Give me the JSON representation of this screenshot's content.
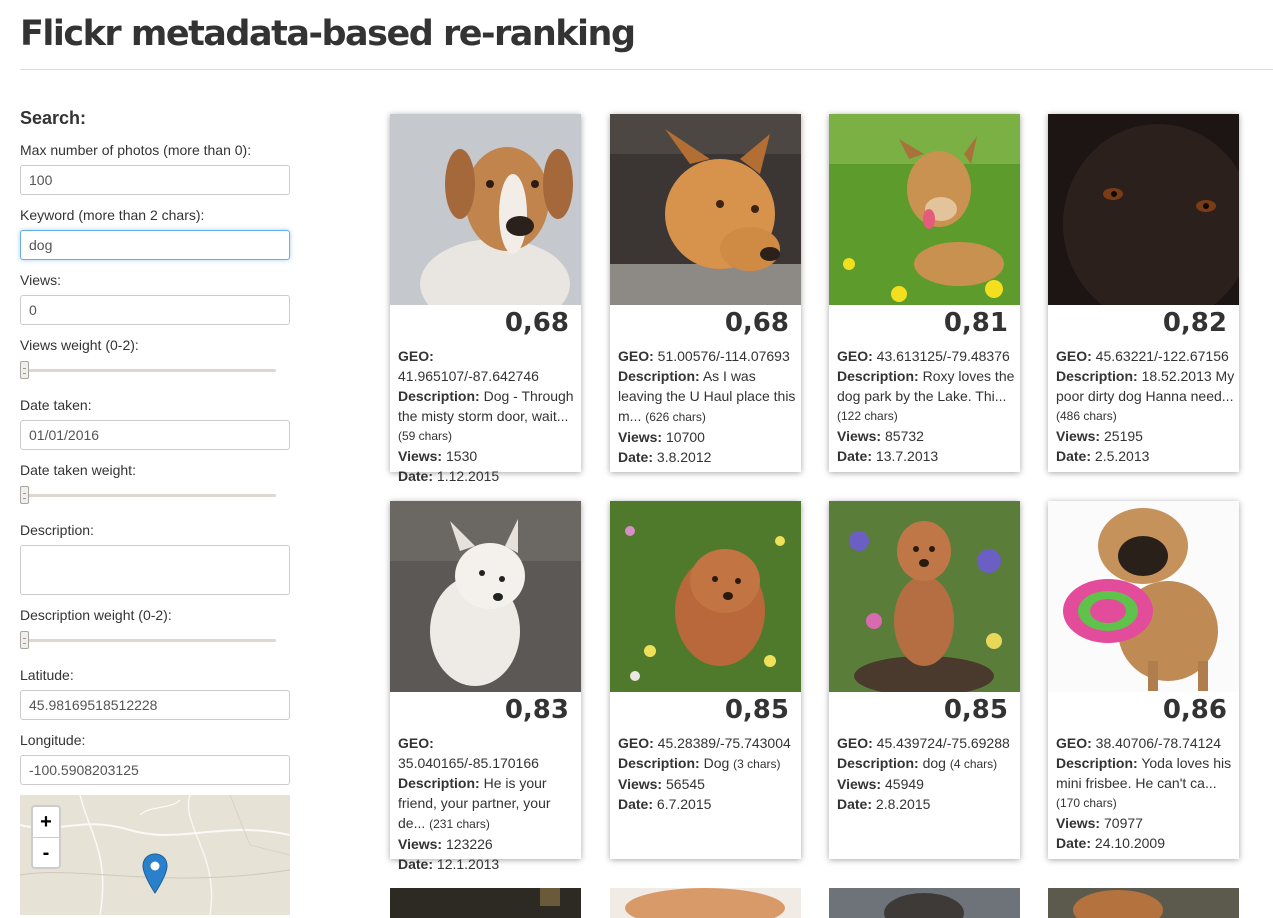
{
  "page_title": "Flickr metadata-based re-ranking",
  "sidebar": {
    "heading": "Search:",
    "max_photos_label": "Max number of photos (more than 0):",
    "max_photos_value": "100",
    "keyword_label": "Keyword (more than 2 chars):",
    "keyword_value": "dog",
    "views_label": "Views:",
    "views_value": "0",
    "views_weight_label": "Views weight (0-2):",
    "views_weight": 0,
    "date_label": "Date taken:",
    "date_value": "01/01/2016",
    "date_weight_label": "Date taken weight:",
    "date_weight": 0,
    "description_label": "Description:",
    "description_value": "",
    "description_weight_label": "Description weight (0-2):",
    "description_weight": 0,
    "latitude_label": "Latitude:",
    "latitude_value": "45.98169518512228",
    "longitude_label": "Longitude:",
    "longitude_value": "-100.5908203125",
    "map": {
      "zoom_in": "+",
      "zoom_out": "-"
    }
  },
  "labels": {
    "geo": "GEO:",
    "description": "Description:",
    "views": "Views:",
    "date": "Date:"
  },
  "results": [
    {
      "score": "0,68",
      "geo": "41.965107/-87.642746",
      "description": "Dog - Through the misty storm door, wait...",
      "chars": "(59 chars)",
      "views": "1530",
      "date": "1.12.2015",
      "photo": "dog-portrait-white-brown"
    },
    {
      "score": "0,68",
      "geo": "51.00576/-114.07693",
      "description": "As I was leaving the U Haul place this m...",
      "chars": "(626 chars)",
      "views": "10700",
      "date": "3.8.2012",
      "photo": "dog-in-car-window"
    },
    {
      "score": "0,81",
      "geo": "43.613125/-79.48376",
      "description": "Roxy loves the dog park by the Lake. Thi...",
      "chars": "(122 chars)",
      "views": "85732",
      "date": "13.7.2013",
      "photo": "dog-on-grass"
    },
    {
      "score": "0,82",
      "geo": "45.63221/-122.67156",
      "description": "18.52.2013 My poor dirty dog Hanna need...",
      "chars": "(486 chars)",
      "views": "25195",
      "date": "2.5.2013",
      "photo": "black-dog-closeup"
    },
    {
      "score": "0,83",
      "geo": "35.040165/-85.170166",
      "description": "He is your friend, your partner, your de...",
      "chars": "(231 chars)",
      "views": "123226",
      "date": "12.1.2013",
      "photo": "white-terrier"
    },
    {
      "score": "0,85",
      "geo": "45.28389/-75.743004",
      "description": "Dog",
      "chars": "(3 chars)",
      "views": "56545",
      "date": "6.7.2015",
      "photo": "poodle-in-flowers"
    },
    {
      "score": "0,85",
      "geo": "45.439724/-75.69288",
      "description": "dog",
      "chars": "(4 chars)",
      "views": "45949",
      "date": "2.8.2015",
      "photo": "poodle-standing-flowers"
    },
    {
      "score": "0,86",
      "geo": "38.40706/-78.74124",
      "description": "Yoda loves his mini frisbee. He can't ca...",
      "chars": "(170 chars)",
      "views": "70977",
      "date": "24.10.2009",
      "photo": "pug-with-frisbee"
    }
  ],
  "colors": {
    "accent_focus": "#66afe9",
    "marker": "#2a81cb"
  }
}
